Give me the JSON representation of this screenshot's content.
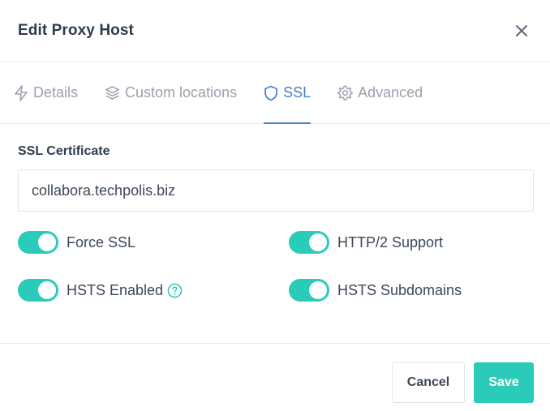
{
  "modal": {
    "title": "Edit Proxy Host",
    "close_icon": "close-icon"
  },
  "tabs": [
    {
      "label": "Details",
      "icon": "lightning-icon",
      "active": false
    },
    {
      "label": "Custom locations",
      "icon": "layers-icon",
      "active": false
    },
    {
      "label": "SSL",
      "icon": "shield-icon",
      "active": true
    },
    {
      "label": "Advanced",
      "icon": "gear-icon",
      "active": false
    }
  ],
  "ssl": {
    "certificate_label": "SSL Certificate",
    "certificate_value": "collabora.techpolis.biz",
    "toggles": [
      {
        "label": "Force SSL",
        "enabled": true
      },
      {
        "label": "HTTP/2 Support",
        "enabled": true
      },
      {
        "label": "HSTS Enabled",
        "enabled": true,
        "help_icon": "help-icon"
      },
      {
        "label": "HSTS Subdomains",
        "enabled": true
      }
    ]
  },
  "footer": {
    "cancel_label": "Cancel",
    "save_label": "Save"
  },
  "colors": {
    "accent": "#467fcf",
    "toggle_on": "#2bcbba",
    "save_button": "#2bcbba"
  }
}
